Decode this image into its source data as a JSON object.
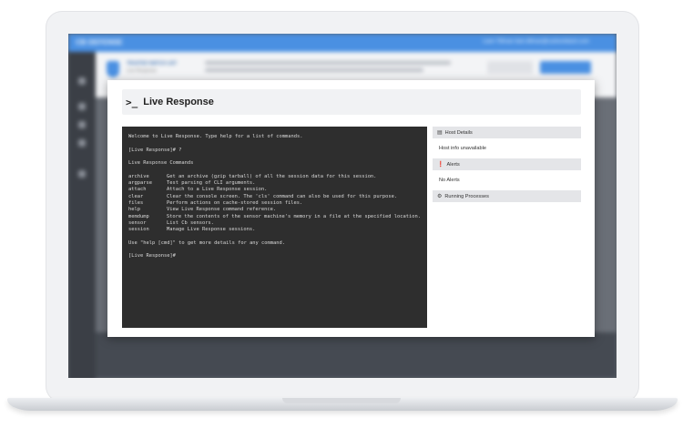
{
  "background_app": {
    "brand": "CB DEFENSE",
    "user": "Liam Tillman liam.tillman@carbonblack.com",
    "banner_title": "TRUSTED WATCH LIST",
    "banner_subtitle": "Live Response"
  },
  "modal": {
    "icon": "terminal-prompt-icon",
    "title": "Live Response"
  },
  "terminal": {
    "welcome": "Welcome to Live Response. Type help for a list of commands.",
    "prompt_1": "[Live Response]# ?",
    "section_title": "Live Response Commands",
    "commands": [
      {
        "name": "archive",
        "desc": "Get an archive (gzip tarball) of all the session data for this session."
      },
      {
        "name": "argparse",
        "desc": "Test parsing of CLI arguments."
      },
      {
        "name": "attach",
        "desc": "Attach to a Live Response session."
      },
      {
        "name": "clear",
        "desc": "Clear the console screen. The 'cls' command can also be used for this purpose."
      },
      {
        "name": "files",
        "desc": "Perform actions on cache-stored session files."
      },
      {
        "name": "help",
        "desc": "View Live Response command reference."
      },
      {
        "name": "memdump",
        "desc": "Store the contents of the sensor machine's memory in a file at the specified location."
      },
      {
        "name": "sensor",
        "desc": "List Cb sensors."
      },
      {
        "name": "session",
        "desc": "Manage Live Response sessions."
      }
    ],
    "help_hint": "Use \"help [cmd]\" to get more details for any command.",
    "prompt_2": "[Live Response]#"
  },
  "side_panel": {
    "host_details_label": "Host Details",
    "host_details_icon": "monitor-icon",
    "host_details_body": "Host info unavailable",
    "alerts_label": "Alerts",
    "alerts_icon": "alert-circle-icon",
    "alerts_body": "No Alerts",
    "processes_label": "Running Processes",
    "processes_icon": "gears-icon"
  },
  "colors": {
    "topbar": "#4a90e2",
    "terminal_bg": "#2e2e2e",
    "terminal_text": "#d8d8d8",
    "panel_header": "#e4e5e8"
  }
}
